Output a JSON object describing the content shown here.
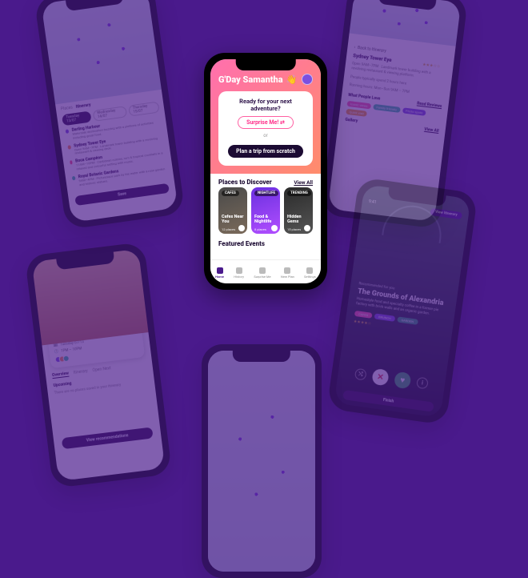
{
  "colors": {
    "bg": "#4a1a8c",
    "accent": "#ff5fa2",
    "dark": "#1c0b33"
  },
  "main": {
    "greeting": "G'Day Samantha",
    "wave_emoji": "👋",
    "prompt": "Ready for your next adventure?",
    "surprise": "Surprise Me!",
    "or": "or",
    "scratch": "Plan a trip from scratch",
    "discover_title": "Places to Discover",
    "viewall": "View All",
    "tiles": [
      {
        "badge": "CAFES",
        "title": "Cafes Near You",
        "meta": "12 places"
      },
      {
        "badge": "NIGHTLIFE",
        "title": "Food & Nightlife",
        "meta": "8 places"
      },
      {
        "badge": "TRENDING",
        "title": "Hidden Gems",
        "meta": "15 places"
      }
    ],
    "featured_title": "Featured Events",
    "tabs": [
      {
        "label": "Home"
      },
      {
        "label": "History"
      },
      {
        "label": "Surprise Me"
      },
      {
        "label": "New Plan"
      },
      {
        "label": "Settings"
      }
    ]
  },
  "itinerary": {
    "tabs": {
      "places": "Places",
      "itinerary": "Itinerary"
    },
    "days": [
      {
        "label": "Tuesday 13/07",
        "active": true
      },
      {
        "label": "Wednesday 14/07",
        "active": false
      },
      {
        "label": "Thursday 15/07",
        "active": false
      }
    ],
    "items": [
      {
        "color": "#7b4fe0",
        "title": "Darling Harbour",
        "desc": "Waterside destination buzzing with a plethora of activities including great food."
      },
      {
        "color": "#ff8c3a",
        "title": "Sydney Tower Eye",
        "desc": "Open 9AM–7PM · Landmark tower building with a revolving restaurant & viewing deck."
      },
      {
        "color": "#ff4f7a",
        "title": "Boca Campéon",
        "desc": "11AM–10PM · Caribbean cuisine, rum & tropical cocktails in a relaxed and colourful setting with music."
      },
      {
        "color": "#34c796",
        "title": "Royal Botanic Gardens",
        "desc": "9AM–4PM · Picturesque park by the water with a rose garden and historic statues."
      }
    ],
    "save": "Save"
  },
  "detail": {
    "back": "Back to Itinerary",
    "title": "Sydney Tower Eye",
    "stars": "★★★☆☆",
    "hours": "Open 9AM–7PM · Landmark tower building with a revolving restaurant & viewing platform.",
    "busy": "People typically spend 2 hours here",
    "run": "Running hours: Mon–Sun 9AM – 7PM",
    "love_title": "What People Love",
    "read": "Read Reviews",
    "tags": [
      "Iconic views",
      "Family friendly",
      "Photo spots",
      "Quick visit"
    ],
    "gallery": "Gallery",
    "viewall": "View All"
  },
  "place": {
    "time": "9:41",
    "itinerary_pill": "View Itinerary",
    "recommended": "Recommended for you",
    "title": "The Grounds of Alexandria",
    "desc": "Homestyle food and specialty coffee in a former pie factory with brick walls and an organic garden.",
    "tags": [
      {
        "text": "CAFES",
        "color": "#ff5fa2"
      },
      {
        "text": "BRUNCH",
        "color": "#7b4fe0"
      },
      {
        "text": "GARDEN",
        "color": "#2aa56a"
      }
    ],
    "stars": "★★★★☆",
    "finish": "Finish"
  },
  "sanfran": {
    "title": "A Day in San Fran 🌉🍔",
    "date": "Tuesday 07/13",
    "time": "1PM – 10PM",
    "tabs": [
      "Overview",
      "Itinerary",
      "Open Next"
    ],
    "upcoming": "Upcoming",
    "empty": "There are no places saved in your itinerary",
    "button": "View recommendations"
  }
}
